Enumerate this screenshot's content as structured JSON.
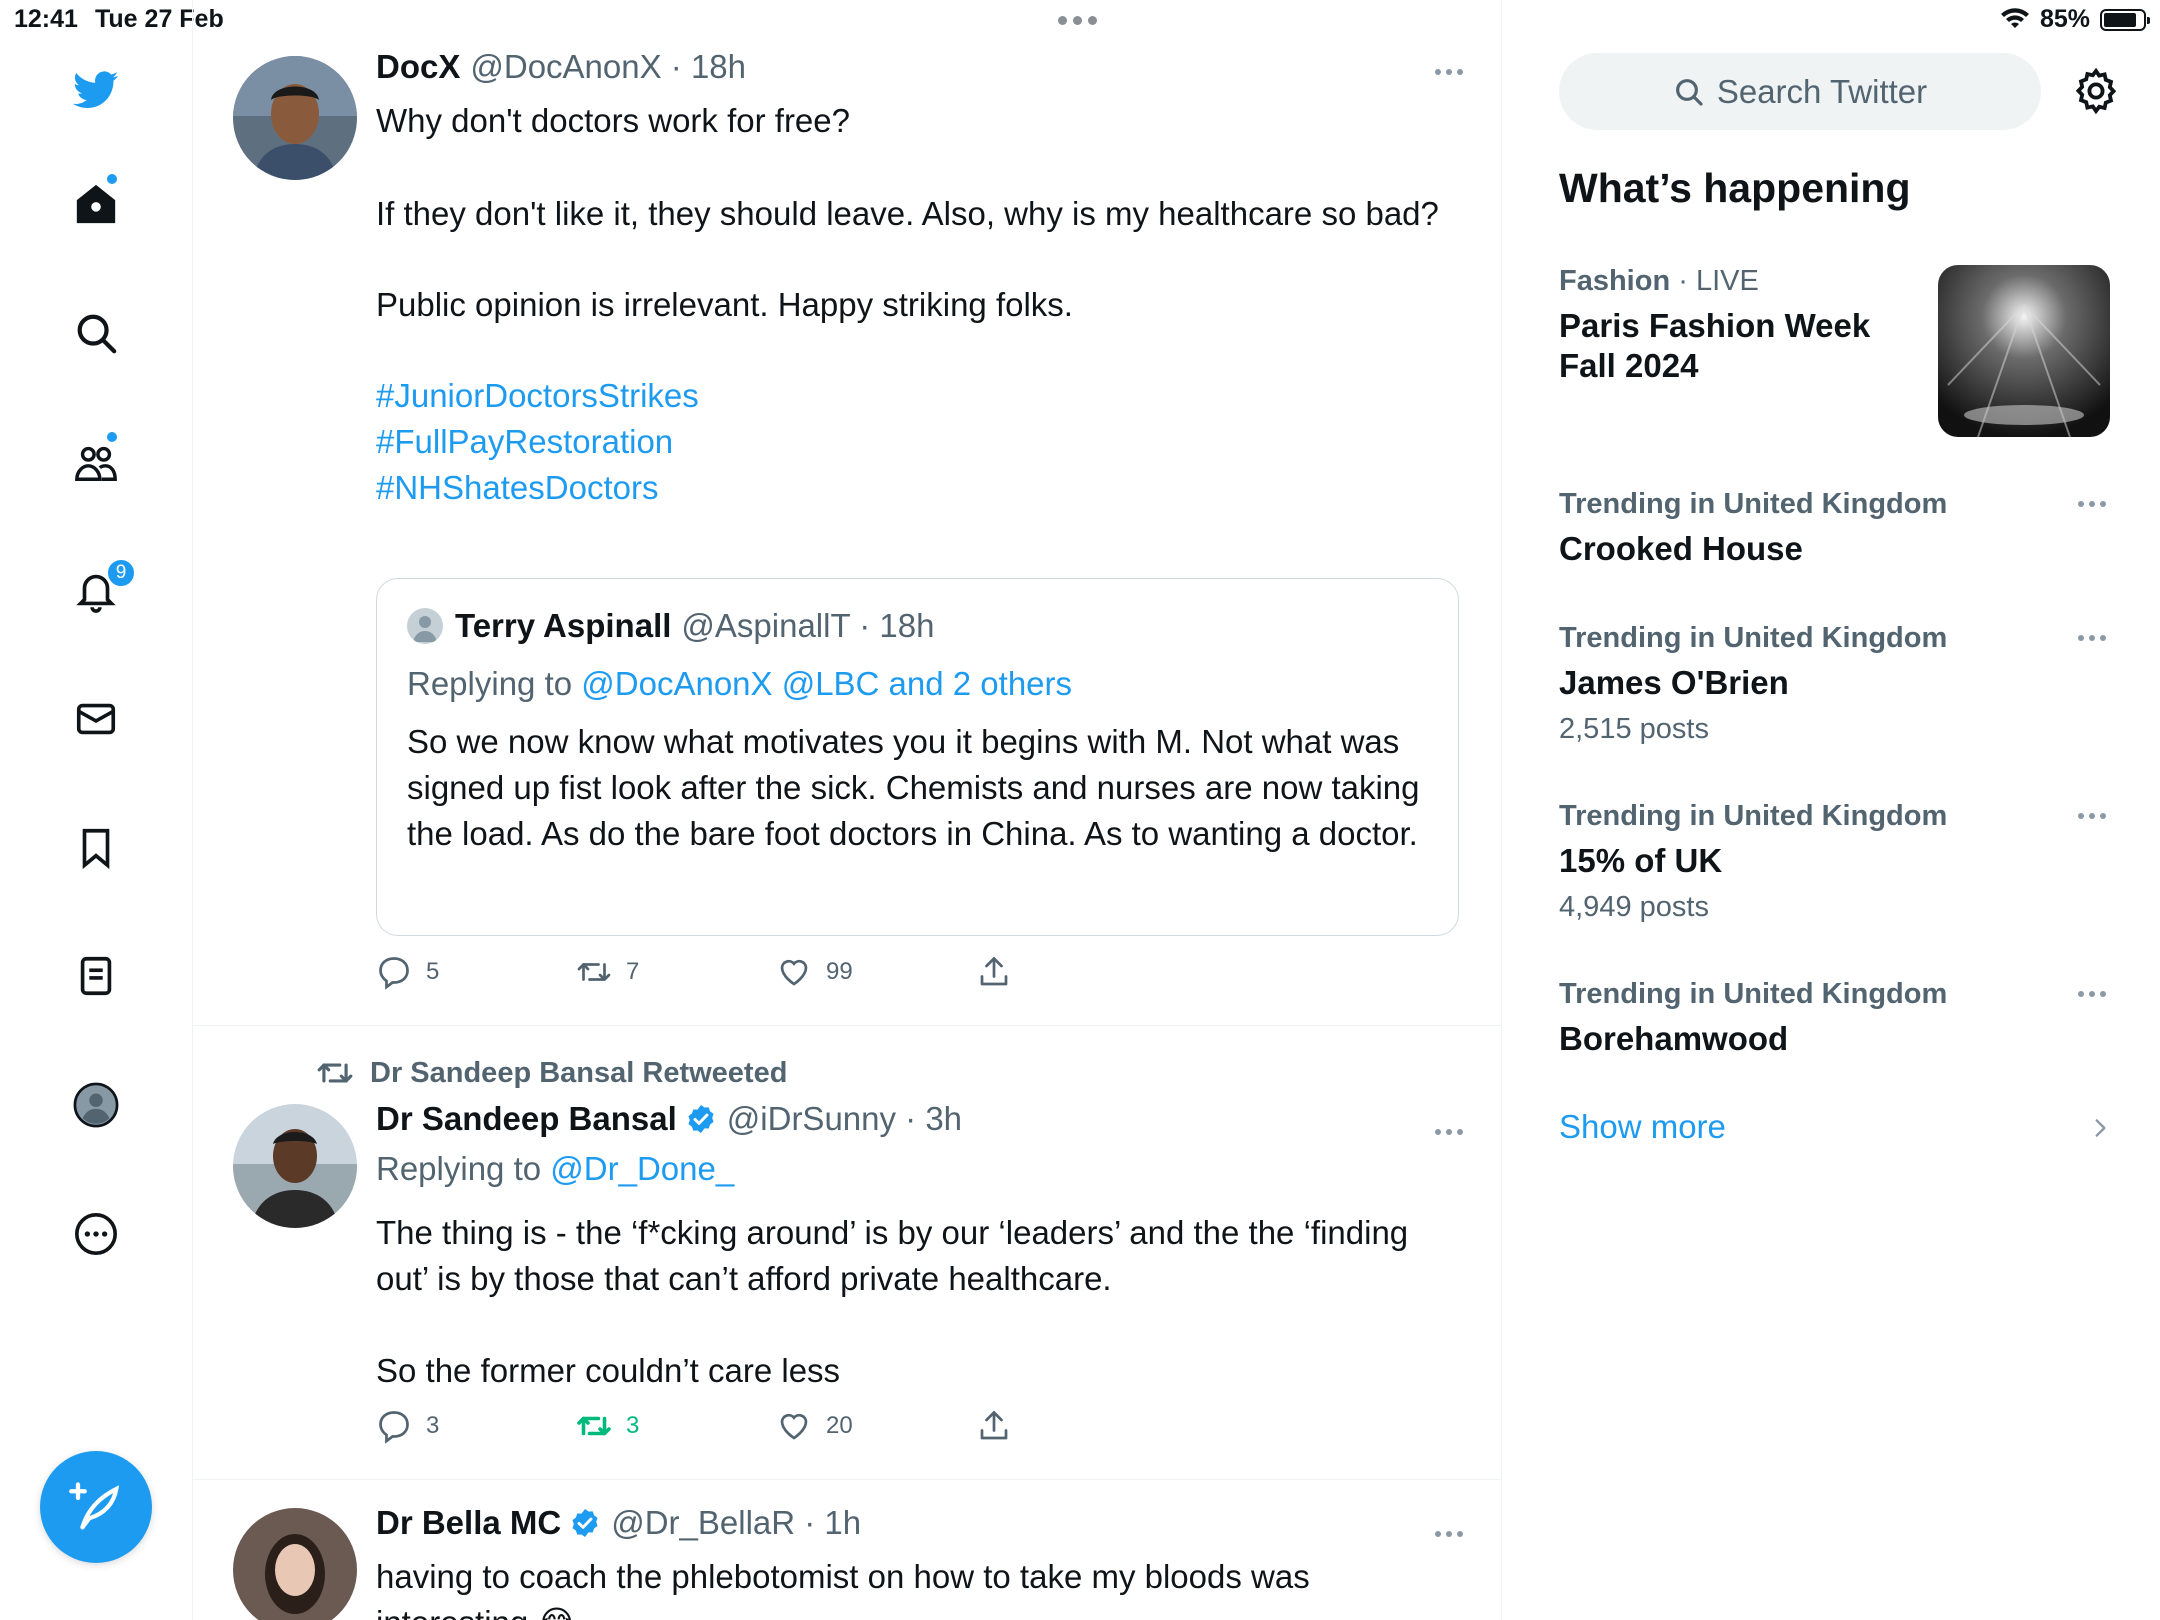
{
  "status_bar": {
    "time": "12:41",
    "date": "Tue 27 Feb",
    "battery": "85%",
    "battery_level": 0.85
  },
  "nav": {
    "notifications_badge": "9",
    "items": [
      "twitter-logo",
      "home",
      "explore",
      "communities",
      "notifications",
      "messages",
      "bookmarks",
      "lists",
      "profile",
      "more"
    ]
  },
  "tweets": [
    {
      "name": "DocX",
      "handle": "@DocAnonX · 18h",
      "lines": [
        "Why don't doctors work for free?",
        "If they don't like it, they should leave. Also, why is my healthcare so bad?",
        "Public opinion is irrelevant. Happy striking folks."
      ],
      "hashtags": [
        "#JuniorDoctorsStrikes",
        "#FullPayRestoration",
        "#NHShatesDoctors"
      ],
      "quote": {
        "name": "Terry Aspinall",
        "handle": "@AspinallT · 18h",
        "replying_prefix": "Replying to ",
        "replying_to": "@DocAnonX @LBC and 2 others",
        "text": "So we now know what motivates you it begins with M. Not what was signed up fist look after the sick. Chemists and nurses are now taking the load. As do the bare foot doctors in China. As to wanting a doctor."
      },
      "replies": "5",
      "retweets": "7",
      "likes": "99"
    },
    {
      "retweeted_by": "Dr Sandeep Bansal Retweeted",
      "name": "Dr Sandeep Bansal",
      "handle": "@iDrSunny · 3h",
      "replying_prefix": "Replying to ",
      "replying_to": "@Dr_Done_",
      "lines": [
        "The thing is - the ‘f*cking around’ is by our ‘leaders’ and the the ‘finding out’ is by those that can’t afford private healthcare.",
        "So the former couldn’t care less"
      ],
      "replies": "3",
      "retweets": "3",
      "likes": "20"
    },
    {
      "name": "Dr Bella MC",
      "handle": "@Dr_BellaR · 1h",
      "lines": [
        "having to coach the phlebotomist on how to take my bloods was interesting 😂"
      ]
    }
  ],
  "sidebar": {
    "search_placeholder": "Search Twitter",
    "section_title": "What’s happening",
    "trends": [
      {
        "category": "Fashion",
        "suffix": " · LIVE",
        "title": "Paris Fashion Week Fall 2024",
        "count": ""
      },
      {
        "category": "Trending in United Kingdom",
        "suffix": "",
        "title": "Crooked House",
        "count": ""
      },
      {
        "category": "Trending in United Kingdom",
        "suffix": "",
        "title": "James O'Brien",
        "count": "2,515 posts"
      },
      {
        "category": "Trending in United Kingdom",
        "suffix": "",
        "title": "15% of UK",
        "count": "4,949 posts"
      },
      {
        "category": "Trending in United Kingdom",
        "suffix": "",
        "title": "Borehamwood",
        "count": ""
      }
    ],
    "show_more": "Show more"
  },
  "colors": {
    "accent": "#1d9bf0",
    "retweet_green": "#00ba7c",
    "secondary_text": "#536471"
  }
}
